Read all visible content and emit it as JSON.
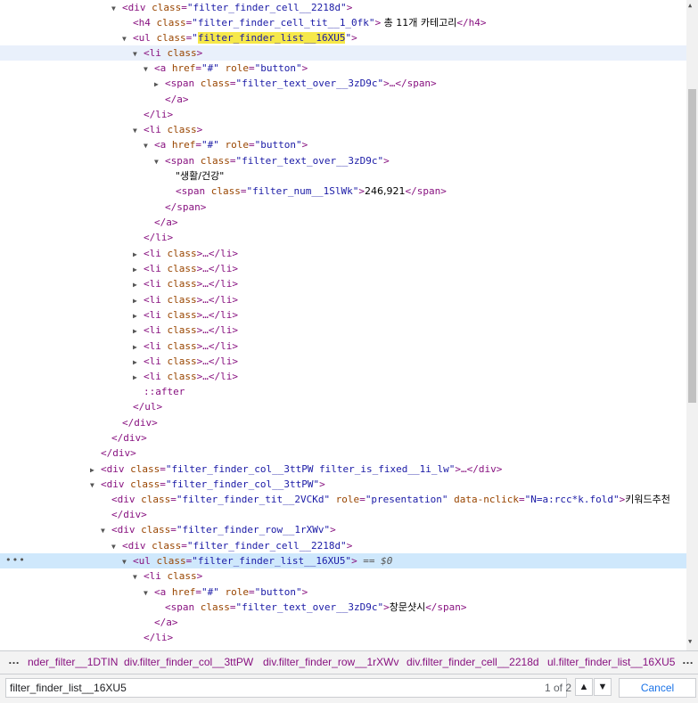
{
  "dom_tree": {
    "l1": {
      "tag_open": "<div ",
      "attr1_name": "class",
      "eq": "=",
      "attr1_val": "\"filter_finder_cell__2218d\"",
      "close": ">"
    },
    "l2": {
      "tag_open": "<h4 ",
      "attr1_name": "class",
      "eq": "=",
      "attr1_val": "\"filter_finder_cell_tit__1_0fk\"",
      "close": ">",
      "text": " 총 11개 카테고리",
      "end_tag": "</h4>"
    },
    "l3": {
      "tag_open": "<ul ",
      "attr1_name": "class",
      "eq": "=",
      "q1": "\"",
      "attr1_val": "filter_finder_list__16XU5",
      "q2": "\"",
      "close": ">"
    },
    "l4": {
      "tag_open": "<li ",
      "attr1_name": "class",
      "close": ">"
    },
    "l5": {
      "tag_open": "<a ",
      "attr1_name": "href",
      "eq": "=",
      "attr1_val": "\"#\"",
      "attr2_name": " role",
      "eq2": "=",
      "attr2_val": "\"button\"",
      "close": ">"
    },
    "l6": {
      "tag_open": "<span ",
      "attr1_name": "class",
      "eq": "=",
      "attr1_val": "\"filter_text_over__3zD9c\"",
      "close": ">…</span>"
    },
    "l7": {
      "tag": "</a>"
    },
    "l8": {
      "tag": "</li>"
    },
    "l9": {
      "tag_open": "<li ",
      "attr1_name": "class",
      "close": ">"
    },
    "l10": {
      "tag_open": "<a ",
      "attr1_name": "href",
      "eq": "=",
      "attr1_val": "\"#\"",
      "attr2_name": " role",
      "eq2": "=",
      "attr2_val": "\"button\"",
      "close": ">"
    },
    "l11": {
      "tag_open": "<span ",
      "attr1_name": "class",
      "eq": "=",
      "attr1_val": "\"filter_text_over__3zD9c\"",
      "close": ">"
    },
    "l12": {
      "text": "\"생활/건강\""
    },
    "l13": {
      "tag_open": "<span ",
      "attr1_name": "class",
      "eq": "=",
      "attr1_val": "\"filter_num__1SlWk\"",
      "close": ">",
      "text": "246,921",
      "end_tag": "</span>"
    },
    "l14": {
      "tag": "</span>"
    },
    "l15": {
      "tag": "</a>"
    },
    "l16": {
      "tag": "</li>"
    },
    "collapsed_li": {
      "tag_open": "<li ",
      "attr1_name": "class",
      "close": ">…</li>"
    },
    "l26": {
      "pseudo": "::after"
    },
    "l27": {
      "tag": "</ul>"
    },
    "l28": {
      "tag": "</div>"
    },
    "l29": {
      "tag": "</div>"
    },
    "l30": {
      "tag": "</div>"
    },
    "l31": {
      "tag_open": "<div ",
      "attr1_name": "class",
      "eq": "=",
      "attr1_val": "\"filter_finder_col__3ttPW filter_is_fixed__1i_lw\"",
      "close": ">…</div>"
    },
    "l32": {
      "tag_open": "<div ",
      "attr1_name": "class",
      "eq": "=",
      "attr1_val": "\"filter_finder_col__3ttPW\"",
      "close": ">"
    },
    "l33": {
      "tag_open": "<div ",
      "attr1_name": "class",
      "eq": "=",
      "attr1_val": "\"filter_finder_tit__2VCKd\"",
      "attr2_name": " role",
      "eq2": "=",
      "attr2_val": "\"presentation\"",
      "attr3_name": " data-nclick",
      "eq3": "=",
      "attr3_val": "\"N=a:rcc*k.fold\"",
      "close": ">",
      "text": "키워드추천"
    },
    "l34": {
      "tag": "</div>"
    },
    "l35": {
      "tag_open": "<div ",
      "attr1_name": "class",
      "eq": "=",
      "attr1_val": "\"filter_finder_row__1rXWv\"",
      "close": ">"
    },
    "l36": {
      "tag_open": "<div ",
      "attr1_name": "class",
      "eq": "=",
      "attr1_val": "\"filter_finder_cell__2218d\"",
      "close": ">"
    },
    "l37": {
      "tag_open": "<ul ",
      "attr1_name": "class",
      "eq": "=",
      "attr1_val": "\"filter_finder_list__16XU5\"",
      "close": ">",
      "eqdollar": " == $0",
      "dots": "•••"
    },
    "l38": {
      "tag_open": "<li ",
      "attr1_name": "class",
      "close": ">"
    },
    "l39": {
      "tag_open": "<a ",
      "attr1_name": "href",
      "eq": "=",
      "attr1_val": "\"#\"",
      "attr2_name": " role",
      "eq2": "=",
      "attr2_val": "\"button\"",
      "close": ">"
    },
    "l40": {
      "tag_open": "<span ",
      "attr1_name": "class",
      "eq": "=",
      "attr1_val": "\"filter_text_over__3zD9c\"",
      "close": ">",
      "text": "창문샷시",
      "end_tag": "</span>"
    },
    "l41": {
      "tag": "</a>"
    },
    "l42": {
      "tag": "</li>"
    }
  },
  "breadcrumb": {
    "more_left": "…",
    "items": [
      "nder_filter__1DTIN",
      "div.filter_finder_col__3ttPW",
      "div.filter_finder_row__1rXWv",
      "div.filter_finder_cell__2218d",
      "ul.filter_finder_list__16XU5"
    ],
    "more_right": "…"
  },
  "search": {
    "value": "filter_finder_list__16XU5",
    "count": "1 of 2",
    "prev_icon": "▲",
    "next_icon": "▼",
    "cancel_label": "Cancel"
  },
  "colors": {
    "tag": "#881280",
    "attr_name": "#994500",
    "attr_value": "#1a1aa6",
    "highlight": "#f6e84a",
    "selected_row": "#cfe8fc"
  }
}
